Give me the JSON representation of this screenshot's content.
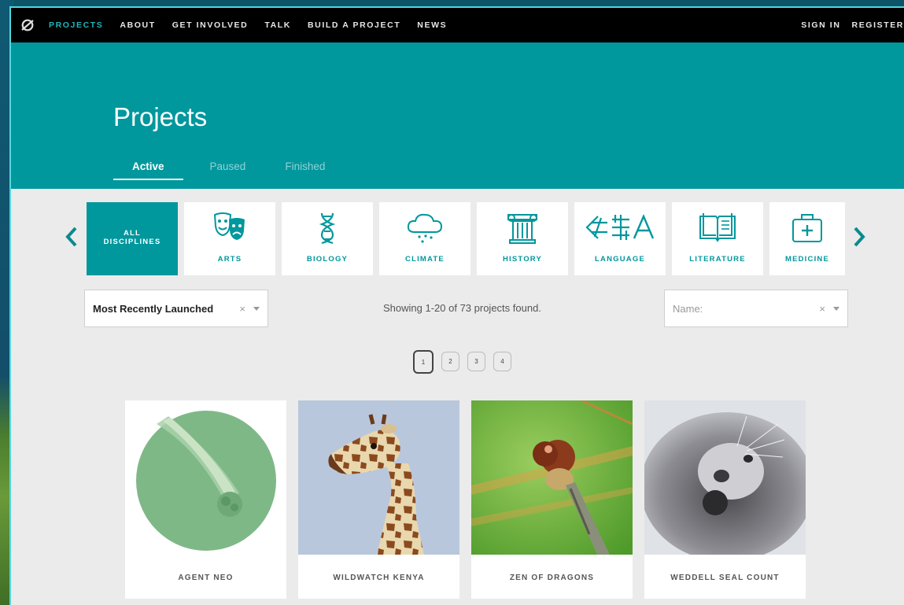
{
  "nav": {
    "items": [
      "PROJECTS",
      "ABOUT",
      "GET INVOLVED",
      "TALK",
      "BUILD A PROJECT",
      "NEWS"
    ],
    "sign_in": "SIGN IN",
    "register": "REGISTER"
  },
  "hero": {
    "title": "Projects",
    "tabs": [
      "Active",
      "Paused",
      "Finished"
    ]
  },
  "disciplines": [
    {
      "label": "ALL DISCIPLINES",
      "icon": "none"
    },
    {
      "label": "ARTS",
      "icon": "theater-masks-icon"
    },
    {
      "label": "BIOLOGY",
      "icon": "dna-icon"
    },
    {
      "label": "CLIMATE",
      "icon": "rain-cloud-icon"
    },
    {
      "label": "HISTORY",
      "icon": "column-icon"
    },
    {
      "label": "LANGUAGE",
      "icon": "glyphs-icon"
    },
    {
      "label": "LITERATURE",
      "icon": "open-book-icon"
    },
    {
      "label": "MEDICINE",
      "icon": "medical-kit-icon"
    }
  ],
  "sort": {
    "value": "Most Recently Launched",
    "clear": "×"
  },
  "status": "Showing 1-20 of 73 projects found.",
  "name_filter": {
    "placeholder": "Name:",
    "clear": "×"
  },
  "pagination": [
    "1",
    "2",
    "3",
    "4"
  ],
  "projects": [
    {
      "title": "AGENT NEO"
    },
    {
      "title": "WILDWATCH KENYA"
    },
    {
      "title": "ZEN OF DRAGONS"
    },
    {
      "title": "WEDDELL SEAL COUNT"
    }
  ],
  "colors": {
    "brand_teal": "#00979d",
    "nav_bg": "#000000",
    "page_bg": "#ebebeb"
  }
}
